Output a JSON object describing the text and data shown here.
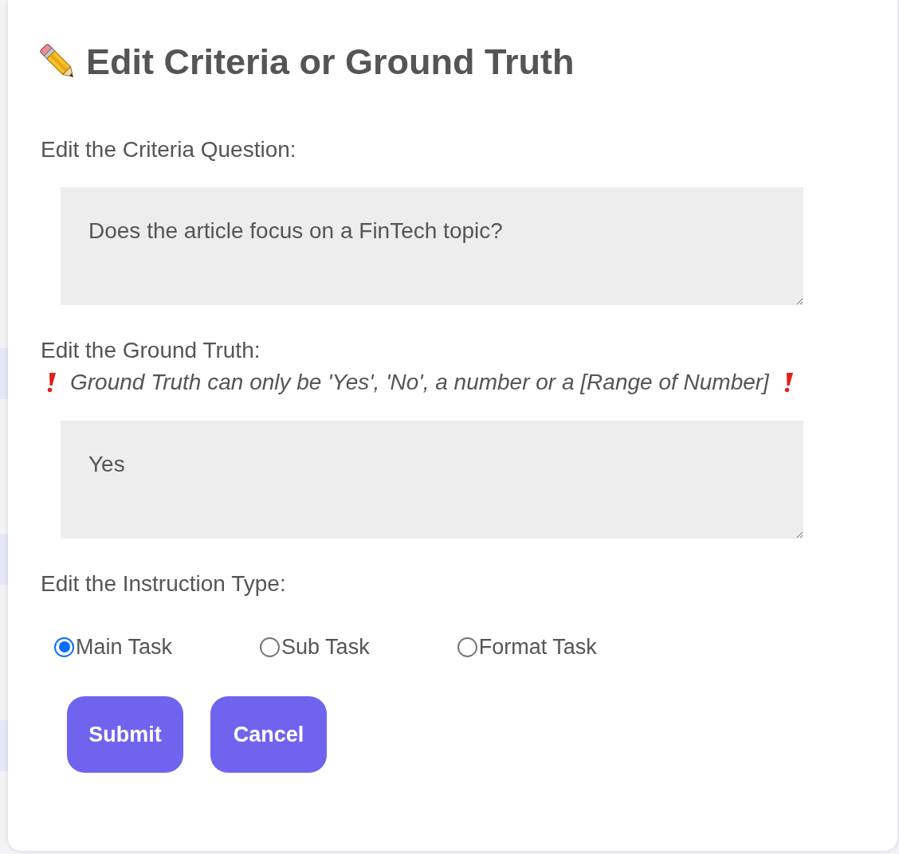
{
  "dialog": {
    "title": "Edit Criteria or Ground Truth",
    "criteria": {
      "label": "Edit the Criteria Question:",
      "value": "Does the article focus on a FinTech topic?"
    },
    "ground_truth": {
      "label": "Edit the Ground Truth:",
      "warning": "Ground Truth can only be 'Yes', 'No', a number or a [Range of Number]",
      "value": "Yes"
    },
    "instruction_type": {
      "label": "Edit the Instruction Type:",
      "options": [
        {
          "label": "Main Task",
          "selected": true
        },
        {
          "label": "Sub Task",
          "selected": false
        },
        {
          "label": "Format Task",
          "selected": false
        }
      ]
    },
    "buttons": [
      "Submit",
      "Cancel"
    ]
  }
}
